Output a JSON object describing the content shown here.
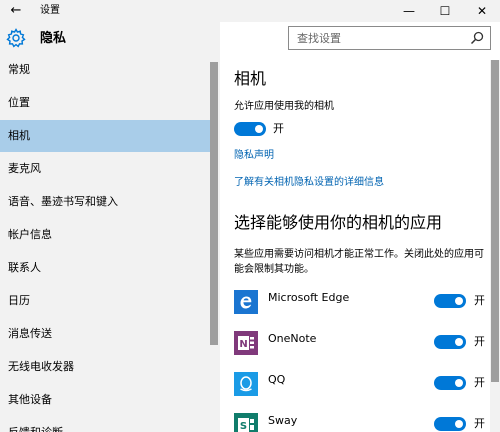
{
  "window": {
    "title": "设置",
    "back_glyph": "←",
    "minimize_glyph": "—",
    "maximize_glyph": "☐",
    "close_glyph": "✕"
  },
  "sidebar": {
    "header_title": "隐私",
    "header_icon": "gear-icon",
    "active_index": 2,
    "items": [
      {
        "label": "常规"
      },
      {
        "label": "位置"
      },
      {
        "label": "相机"
      },
      {
        "label": "麦克风"
      },
      {
        "label": "语音、墨迹书写和键入"
      },
      {
        "label": "帐户信息"
      },
      {
        "label": "联系人"
      },
      {
        "label": "日历"
      },
      {
        "label": "消息传送"
      },
      {
        "label": "无线电收发器"
      },
      {
        "label": "其他设备"
      },
      {
        "label": "反馈和诊断"
      }
    ]
  },
  "search": {
    "placeholder": "查找设置",
    "icon": "search-icon"
  },
  "main": {
    "title": "相机",
    "allow_label": "允许应用使用我的相机",
    "allow_toggle": {
      "state": "on",
      "label": "开"
    },
    "privacy_link": "隐私声明",
    "learn_more_link": "了解有关相机隐私设置的详细信息",
    "apps_title": "选择能够使用你的相机的应用",
    "apps_desc": "某些应用需要访问相机才能正常工作。关闭此处的应用可能会限制其功能。",
    "apps": [
      {
        "name": "Microsoft Edge",
        "icon": "edge-icon",
        "state": "on",
        "toggle_label": "开"
      },
      {
        "name": "OneNote",
        "icon": "onenote-icon",
        "state": "on",
        "toggle_label": "开"
      },
      {
        "name": "QQ",
        "icon": "qq-icon",
        "state": "on",
        "toggle_label": "开"
      },
      {
        "name": "Sway",
        "icon": "sway-icon",
        "state": "on",
        "toggle_label": "开"
      }
    ]
  },
  "colors": {
    "accent": "#0078d7",
    "link": "#0063b1",
    "selected_bg": "#a9cde9",
    "sidebar_bg": "#f2f2f2"
  }
}
